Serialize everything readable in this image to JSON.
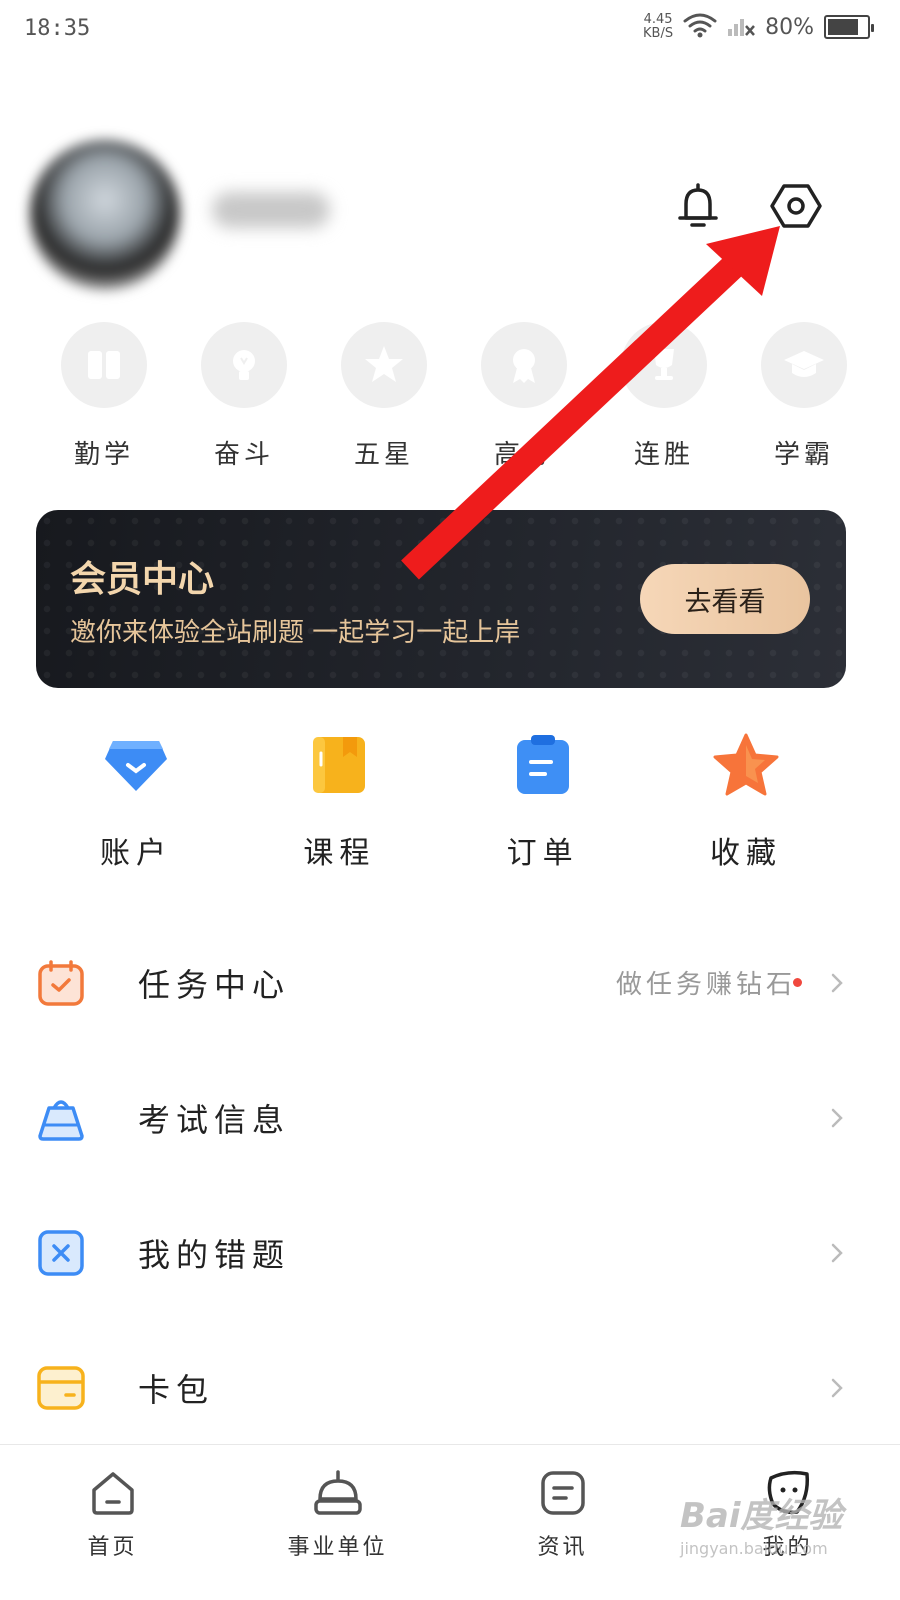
{
  "status_bar": {
    "time": "18:35",
    "net_speed_value": "4.45",
    "net_speed_unit": "KB/S",
    "battery": "80%",
    "battery_level": 0.8
  },
  "header": {
    "icons": [
      "bell-icon",
      "settings-icon"
    ]
  },
  "badges": [
    {
      "label": "勤学",
      "icon": "book-icon"
    },
    {
      "label": "奋斗",
      "icon": "lightbulb-icon"
    },
    {
      "label": "五星",
      "icon": "star-icon"
    },
    {
      "label": "高分",
      "icon": "medal-icon"
    },
    {
      "label": "连胜",
      "icon": "trophy-icon"
    },
    {
      "label": "学霸",
      "icon": "graduation-cap-icon"
    }
  ],
  "member": {
    "title": "会员中心",
    "subtitle": "邀你来体验全站刷题  一起学习一起上岸",
    "button": "去看看"
  },
  "quick_actions": [
    {
      "label": "账户",
      "icon": "wallet-icon",
      "color": "#3d8cf5"
    },
    {
      "label": "课程",
      "icon": "book-icon",
      "color": "#f7b21c"
    },
    {
      "label": "订单",
      "icon": "clipboard-icon",
      "color": "#3e8ff5"
    },
    {
      "label": "收藏",
      "icon": "star-icon",
      "color": "#f7743a"
    }
  ],
  "menu": [
    {
      "label": "任务中心",
      "hint": "做任务赚钻石",
      "icon": "calendar-check-icon",
      "color": "#f2793b"
    },
    {
      "label": "考试信息",
      "hint": "",
      "icon": "bag-icon",
      "color": "#3d8cf5"
    },
    {
      "label": "我的错题",
      "hint": "",
      "icon": "x-box-icon",
      "color": "#3d8cf5"
    },
    {
      "label": "卡包",
      "hint": "",
      "icon": "card-icon",
      "color": "#f7b21c"
    }
  ],
  "bottom_nav": [
    {
      "label": "首页",
      "icon": "home-icon"
    },
    {
      "label": "事业单位",
      "icon": "bell-dome-icon"
    },
    {
      "label": "资讯",
      "icon": "news-icon"
    },
    {
      "label": "我的",
      "icon": "profile-face-icon"
    }
  ],
  "watermark": {
    "main": "Bai度经验",
    "sub": "jingyan.baidu.com"
  },
  "colors": {
    "arrow": "#ee1c1c",
    "member_gold": "#f3d6ad",
    "dot": "#f0483e"
  }
}
